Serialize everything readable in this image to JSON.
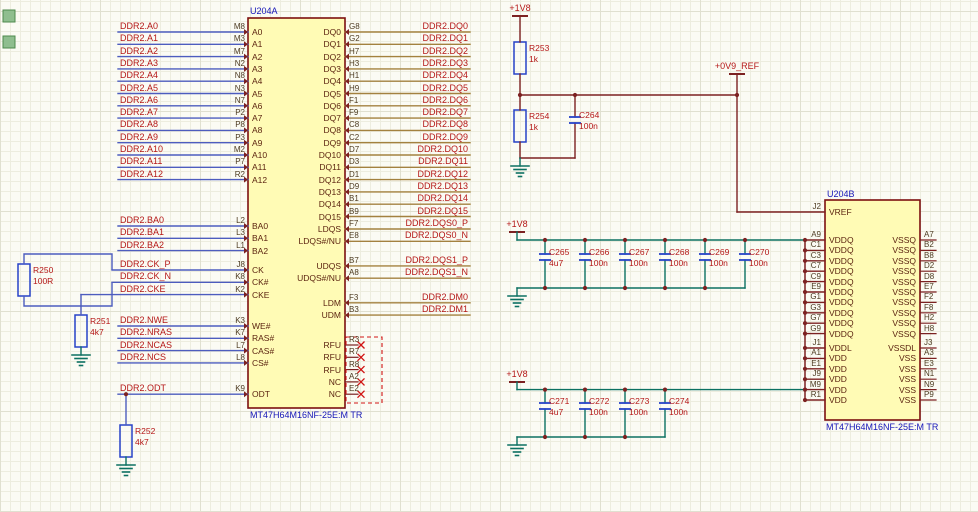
{
  "palette": {
    "bg": "#fbfbf4",
    "grid_minor": "#ededdf",
    "grid_major": "#e0e0d0",
    "body_fill": "#fffbb5",
    "body_border": "#7c1010",
    "pin_name": "#5c2410",
    "pin_number": "#4c3a20",
    "designator": "#1616b8",
    "net_label": "#b51818",
    "wire_signal": "#4d5cbe",
    "wire_dq": "#a3813f",
    "wire_power": "#0c7162",
    "wire_bus": "#7c2121",
    "nc": "#d01414",
    "symbol_blue": "#2743c8",
    "marker_green": "#8fbe8f"
  },
  "u204a": {
    "designator": "U204A",
    "part": "MT47H64M16NF-25E:M TR",
    "left_groups": [
      {
        "pins": [
          {
            "name": "A0",
            "num": "M8",
            "net": "DDR2.A0"
          },
          {
            "name": "A1",
            "num": "M3",
            "net": "DDR2.A1"
          },
          {
            "name": "A2",
            "num": "M7",
            "net": "DDR2.A2"
          },
          {
            "name": "A3",
            "num": "N2",
            "net": "DDR2.A3"
          },
          {
            "name": "A4",
            "num": "N8",
            "net": "DDR2.A4"
          },
          {
            "name": "A5",
            "num": "N3",
            "net": "DDR2.A5"
          },
          {
            "name": "A6",
            "num": "N7",
            "net": "DDR2.A6"
          },
          {
            "name": "A7",
            "num": "P2",
            "net": "DDR2.A7"
          },
          {
            "name": "A8",
            "num": "P8",
            "net": "DDR2.A8"
          },
          {
            "name": "A9",
            "num": "P3",
            "net": "DDR2.A9"
          },
          {
            "name": "A10",
            "num": "M2",
            "net": "DDR2.A10"
          },
          {
            "name": "A11",
            "num": "P7",
            "net": "DDR2.A11"
          },
          {
            "name": "A12",
            "num": "R2",
            "net": "DDR2.A12"
          }
        ]
      },
      {
        "pins": [
          {
            "name": "BA0",
            "num": "L2",
            "net": "DDR2.BA0"
          },
          {
            "name": "BA1",
            "num": "L3",
            "net": "DDR2.BA1"
          },
          {
            "name": "BA2",
            "num": "L1",
            "net": "DDR2.BA2"
          }
        ]
      },
      {
        "pins": [
          {
            "name": "CK",
            "num": "J8",
            "net": "DDR2.CK_P"
          },
          {
            "name": "CK#",
            "num": "K8",
            "net": "DDR2.CK_N"
          },
          {
            "name": "CKE",
            "num": "K2",
            "net": "DDR2.CKE"
          }
        ]
      },
      {
        "pins": [
          {
            "name": "WE#",
            "num": "K3",
            "net": "DDR2.NWE"
          },
          {
            "name": "RAS#",
            "num": "K7",
            "net": "DDR2.NRAS"
          },
          {
            "name": "CAS#",
            "num": "L7",
            "net": "DDR2.NCAS"
          },
          {
            "name": "CS#",
            "num": "L8",
            "net": "DDR2.NCS"
          }
        ]
      },
      {
        "pins": [
          {
            "name": "ODT",
            "num": "K9",
            "net": "DDR2.ODT"
          }
        ]
      }
    ],
    "right_groups": [
      {
        "pins": [
          {
            "name": "DQ0",
            "num": "G8",
            "net": "DDR2.DQ0"
          },
          {
            "name": "DQ1",
            "num": "G2",
            "net": "DDR2.DQ1"
          },
          {
            "name": "DQ2",
            "num": "H7",
            "net": "DDR2.DQ2"
          },
          {
            "name": "DQ3",
            "num": "H3",
            "net": "DDR2.DQ3"
          },
          {
            "name": "DQ4",
            "num": "H1",
            "net": "DDR2.DQ4"
          },
          {
            "name": "DQ5",
            "num": "H9",
            "net": "DDR2.DQ5"
          },
          {
            "name": "DQ6",
            "num": "F1",
            "net": "DDR2.DQ6"
          },
          {
            "name": "DQ7",
            "num": "F9",
            "net": "DDR2.DQ7"
          },
          {
            "name": "DQ8",
            "num": "C8",
            "net": "DDR2.DQ8"
          },
          {
            "name": "DQ9",
            "num": "C2",
            "net": "DDR2.DQ9"
          },
          {
            "name": "DQ10",
            "num": "D7",
            "net": "DDR2.DQ10"
          },
          {
            "name": "DQ11",
            "num": "D3",
            "net": "DDR2.DQ11"
          },
          {
            "name": "DQ12",
            "num": "D1",
            "net": "DDR2.DQ12"
          },
          {
            "name": "DQ13",
            "num": "D9",
            "net": "DDR2.DQ13"
          },
          {
            "name": "DQ14",
            "num": "B1",
            "net": "DDR2.DQ14"
          },
          {
            "name": "DQ15",
            "num": "B9",
            "net": "DDR2.DQ15"
          }
        ]
      },
      {
        "pins": [
          {
            "name": "LDQS",
            "num": "F7",
            "net": "DDR2.DQS0_P"
          },
          {
            "name": "LDQS#/NU",
            "num": "E8",
            "net": "DDR2.DQS0_N"
          }
        ]
      },
      {
        "pins": [
          {
            "name": "UDQS",
            "num": "B7",
            "net": "DDR2.DQS1_P"
          },
          {
            "name": "UDQS#/NU",
            "num": "A8",
            "net": "DDR2.DQS1_N"
          }
        ]
      },
      {
        "pins": [
          {
            "name": "LDM",
            "num": "F3",
            "net": "DDR2.DM0"
          },
          {
            "name": "UDM",
            "num": "B3",
            "net": "DDR2.DM1"
          }
        ]
      },
      {
        "pins": [
          {
            "name": "RFU",
            "num": "R3"
          },
          {
            "name": "RFU",
            "num": "R7"
          },
          {
            "name": "RFU",
            "num": "R8"
          },
          {
            "name": "NC",
            "num": "A2"
          },
          {
            "name": "NC",
            "num": "E2"
          }
        ]
      }
    ]
  },
  "u204b": {
    "designator": "U204B",
    "part": "MT47H64M16NF-25E:M TR",
    "vref": {
      "name": "VREF",
      "num": "J2"
    },
    "left_power": [
      {
        "name": "VDDQ",
        "num": "A9"
      },
      {
        "name": "VDDQ",
        "num": "C1"
      },
      {
        "name": "VDDQ",
        "num": "C3"
      },
      {
        "name": "VDDQ",
        "num": "C7"
      },
      {
        "name": "VDDQ",
        "num": "C9"
      },
      {
        "name": "VDDQ",
        "num": "E9"
      },
      {
        "name": "VDDQ",
        "num": "G1"
      },
      {
        "name": "VDDQ",
        "num": "G3"
      },
      {
        "name": "VDDQ",
        "num": "G7"
      },
      {
        "name": "VDDQ",
        "num": "G9"
      },
      {
        "name": "VDDL",
        "num": "J1"
      },
      {
        "name": "VDD",
        "num": "A1"
      },
      {
        "name": "VDD",
        "num": "E1"
      },
      {
        "name": "VDD",
        "num": "J9"
      },
      {
        "name": "VDD",
        "num": "M9"
      },
      {
        "name": "VDD",
        "num": "R1"
      }
    ],
    "right_power": [
      {
        "name": "VSSQ",
        "num": "A7"
      },
      {
        "name": "VSSQ",
        "num": "B2"
      },
      {
        "name": "VSSQ",
        "num": "B8"
      },
      {
        "name": "VSSQ",
        "num": "D2"
      },
      {
        "name": "VSSQ",
        "num": "D8"
      },
      {
        "name": "VSSQ",
        "num": "E7"
      },
      {
        "name": "VSSQ",
        "num": "F2"
      },
      {
        "name": "VSSQ",
        "num": "F8"
      },
      {
        "name": "VSSQ",
        "num": "H2"
      },
      {
        "name": "VSSQ",
        "num": "H8"
      },
      {
        "name": "VSSDL",
        "num": "J3"
      },
      {
        "name": "VSS",
        "num": "A3"
      },
      {
        "name": "VSS",
        "num": "E3"
      },
      {
        "name": "VSS",
        "num": "N1"
      },
      {
        "name": "VSS",
        "num": "N9"
      },
      {
        "name": "VSS",
        "num": "P9"
      }
    ]
  },
  "resistors": [
    {
      "ref": "R250",
      "value": "100R"
    },
    {
      "ref": "R251",
      "value": "4k7"
    },
    {
      "ref": "R252",
      "value": "4k7"
    },
    {
      "ref": "R253",
      "value": "1k"
    },
    {
      "ref": "R254",
      "value": "1k"
    }
  ],
  "capacitors": {
    "single": [
      {
        "ref": "C264",
        "value": "100n"
      }
    ],
    "mid_bank": [
      {
        "ref": "C265",
        "value": "4u7"
      },
      {
        "ref": "C266",
        "value": "100n"
      },
      {
        "ref": "C267",
        "value": "100n"
      },
      {
        "ref": "C268",
        "value": "100n"
      },
      {
        "ref": "C269",
        "value": "100n"
      },
      {
        "ref": "C270",
        "value": "100n"
      }
    ],
    "bottom_bank": [
      {
        "ref": "C271",
        "value": "4u7"
      },
      {
        "ref": "C272",
        "value": "100n"
      },
      {
        "ref": "C273",
        "value": "100n"
      },
      {
        "ref": "C274",
        "value": "100n"
      }
    ]
  },
  "power_labels": {
    "v18": "+1V8",
    "vref09": "+0V9_REF"
  }
}
